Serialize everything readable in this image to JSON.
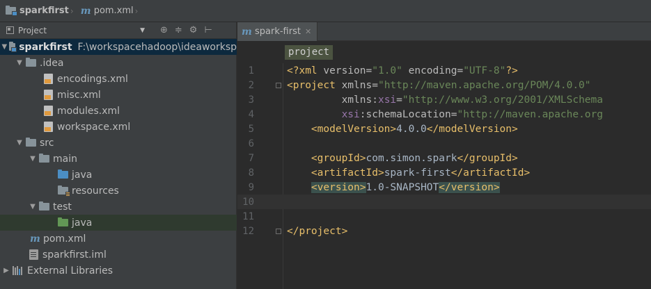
{
  "breadcrumb": {
    "project": "sparkfirst",
    "file": "pom.xml"
  },
  "panel": {
    "title": "Project",
    "tools": [
      "⊕",
      "≑",
      "⚙",
      "⊢"
    ]
  },
  "tree": {
    "root_name": "sparkfirst",
    "root_path": "F:\\workspacehadoop\\ideaworksp",
    "idea": ".idea",
    "encodings": "encodings.xml",
    "misc": "misc.xml",
    "modules": "modules.xml",
    "workspace": "workspace.xml",
    "src": "src",
    "main": "main",
    "java_main": "java",
    "resources": "resources",
    "test": "test",
    "java_test": "java",
    "pom": "pom.xml",
    "iml": "sparkfirst.iml",
    "libs": "External Libraries"
  },
  "editor": {
    "tab_label": "spark-first",
    "tag_chip": "project",
    "line_numbers": [
      "1",
      "2",
      "3",
      "4",
      "5",
      "6",
      "7",
      "8",
      "9",
      "10",
      "11",
      "12"
    ]
  },
  "code": {
    "l1_a": "<?xml ",
    "l1_b": "version=",
    "l1_c": "\"1.0\"",
    "l1_d": " encoding=",
    "l1_e": "\"UTF-8\"",
    "l1_f": "?>",
    "l2_a": "<project ",
    "l2_b": "xmlns=",
    "l2_c": "\"http://maven.apache.org/POM/4.0.0\"",
    "l3_a": "xmlns:",
    "l3_b": "xsi",
    "l3_c": "=",
    "l3_d": "\"http://www.w3.org/2001/XMLSchema",
    "l4_a": "xsi",
    "l4_b": ":schemaLocation=",
    "l4_c": "\"http://maven.apache.org",
    "l5_a": "<modelVersion>",
    "l5_b": "4.0.0",
    "l5_c": "</modelVersion>",
    "l7_a": "<groupId>",
    "l7_b": "com.simon.spark",
    "l7_c": "</groupId>",
    "l8_a": "<artifactId>",
    "l8_b": "spark-first",
    "l8_c": "</artifactId>",
    "l9_a": "<version>",
    "l9_b": "1.0-SNAPSHOT",
    "l9_c": "</version>",
    "l12_a": "</project>"
  }
}
